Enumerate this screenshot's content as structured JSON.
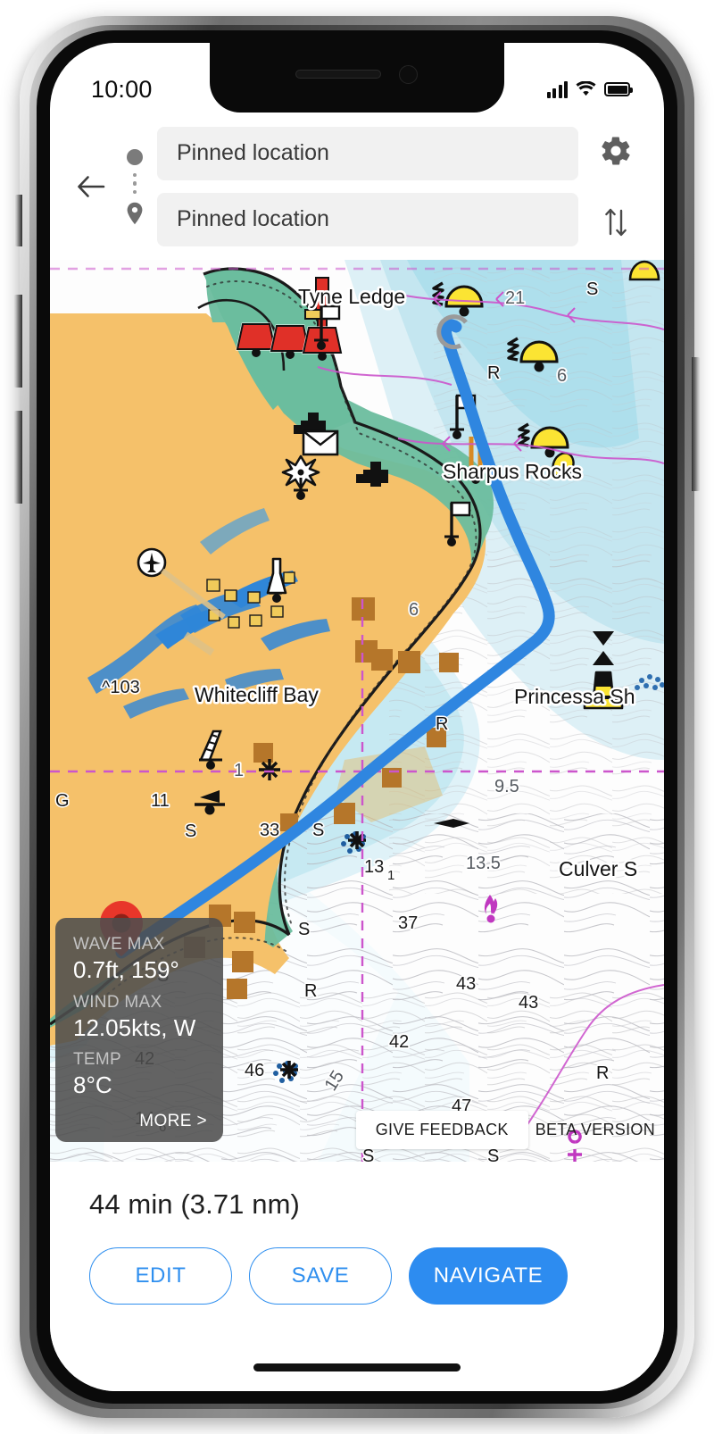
{
  "status_bar": {
    "time": "10:00",
    "signal_icon": "cellular-signal-icon",
    "wifi_icon": "wifi-icon",
    "battery_icon": "battery-full-icon"
  },
  "header": {
    "back_icon": "back-arrow-icon",
    "origin_icon": "origin-dot-icon",
    "waypoint_icon": "vertical-dots-icon",
    "destination_icon": "map-pin-icon",
    "origin_value": "Pinned location",
    "origin_placeholder": "Pinned location",
    "destination_value": "Pinned location",
    "destination_placeholder": "Pinned location",
    "settings_icon": "gear-icon",
    "swap_icon": "swap-vertical-icon"
  },
  "map": {
    "place_labels": [
      "Tyne Ledge",
      "Sharpus Rocks",
      "Whitecliff Bay",
      "Princessa Sh",
      "Culver S"
    ],
    "soundings": [
      "21",
      "6",
      "6",
      "^103",
      "11",
      "1",
      "33",
      "9.5",
      "13.5",
      "37",
      "43",
      "43",
      "42",
      "46",
      "47",
      "15",
      "14",
      "42"
    ],
    "sounding_13_1": "13",
    "sounding_13_1_sub": "1",
    "sounding_14_6": "14",
    "sounding_14_6_sub": "6",
    "seabed_quality": [
      "S",
      "S",
      "S",
      "S",
      "S",
      "S",
      "R",
      "R",
      "R",
      "G"
    ],
    "route_color": "#2f86e0",
    "land_color": "#f5c16a",
    "foreshore_color": "#6bbd9e",
    "shallow_color": "#a8dbe8",
    "deep_color": "#ffffff",
    "grid_color": "#cc55cc",
    "pin_color": "#e8362a",
    "buoy_color": "#fbe433",
    "start_pin_icon": "route-start-pin-icon",
    "end_circle_icon": "route-end-circle-icon"
  },
  "weather_card": {
    "wave_label": "WAVE MAX",
    "wave_value": "0.7ft, 159°",
    "wind_label": "WIND MAX",
    "wind_value": "12.05kts, W",
    "temp_label": "TEMP",
    "temp_value": "8°C",
    "more_label": "MORE >"
  },
  "map_overlay": {
    "give_feedback": "GIVE FEEDBACK",
    "beta_version": "BETA VERSION"
  },
  "bottom_sheet": {
    "eta": "44 min (3.71 nm)",
    "edit_label": "EDIT",
    "save_label": "SAVE",
    "navigate_label": "NAVIGATE",
    "accent_color": "#2d8cf0"
  }
}
